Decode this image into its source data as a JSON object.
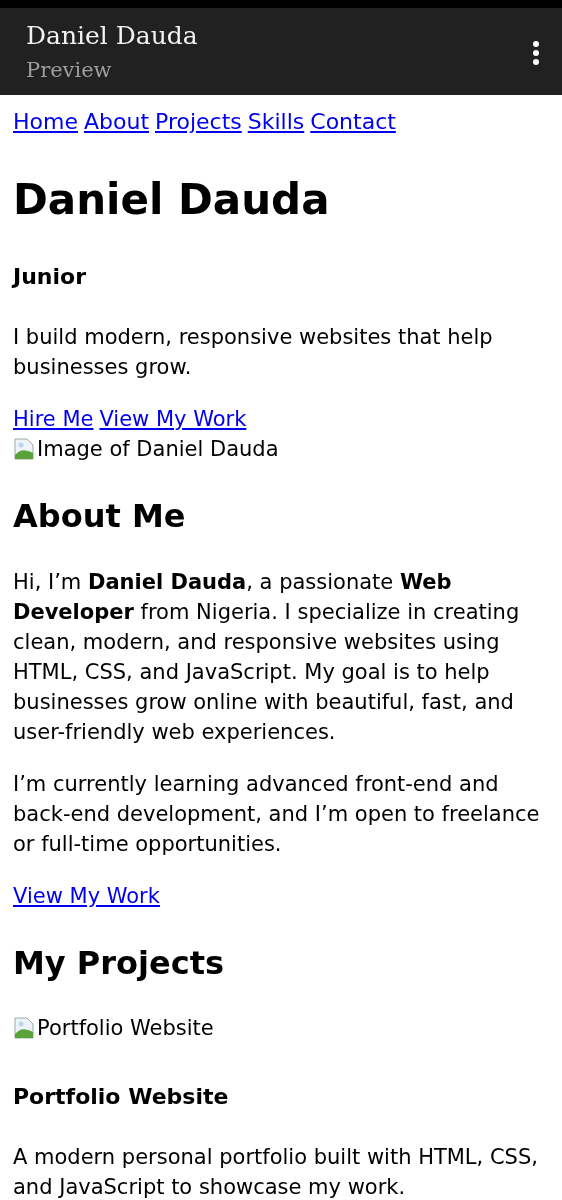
{
  "app_bar": {
    "title": "Daniel Dauda",
    "subtitle": "Preview"
  },
  "nav": [
    "Home",
    "About",
    "Projects",
    "Skills",
    "Contact"
  ],
  "hero": {
    "heading": "Daniel Dauda",
    "subheading": "Junior",
    "intro": "I build modern, responsive websites that help businesses grow.",
    "links": [
      "Hire Me",
      "View My Work"
    ],
    "image_alt": "Image of Daniel Dauda"
  },
  "about": {
    "heading": "About Me",
    "paragraphs": [
      "Hi, I’m **Daniel Dauda**, a passionate **Web Developer** from Nigeria. I specialize in creating clean, modern, and responsive websites using HTML, CSS, and JavaScript. My goal is to help businesses grow online with beautiful, fast, and user-friendly web experiences.",
      "I’m currently learning advanced front-end and back-end development, and I’m open to freelance or full-time opportunities."
    ],
    "link": "View My Work"
  },
  "projects": {
    "heading": "My Projects",
    "items": [
      {
        "image_alt": "Portfolio Website",
        "title": "Portfolio Website",
        "description": "A modern personal portfolio built with HTML, CSS, and JavaScript to showcase my work."
      }
    ]
  }
}
